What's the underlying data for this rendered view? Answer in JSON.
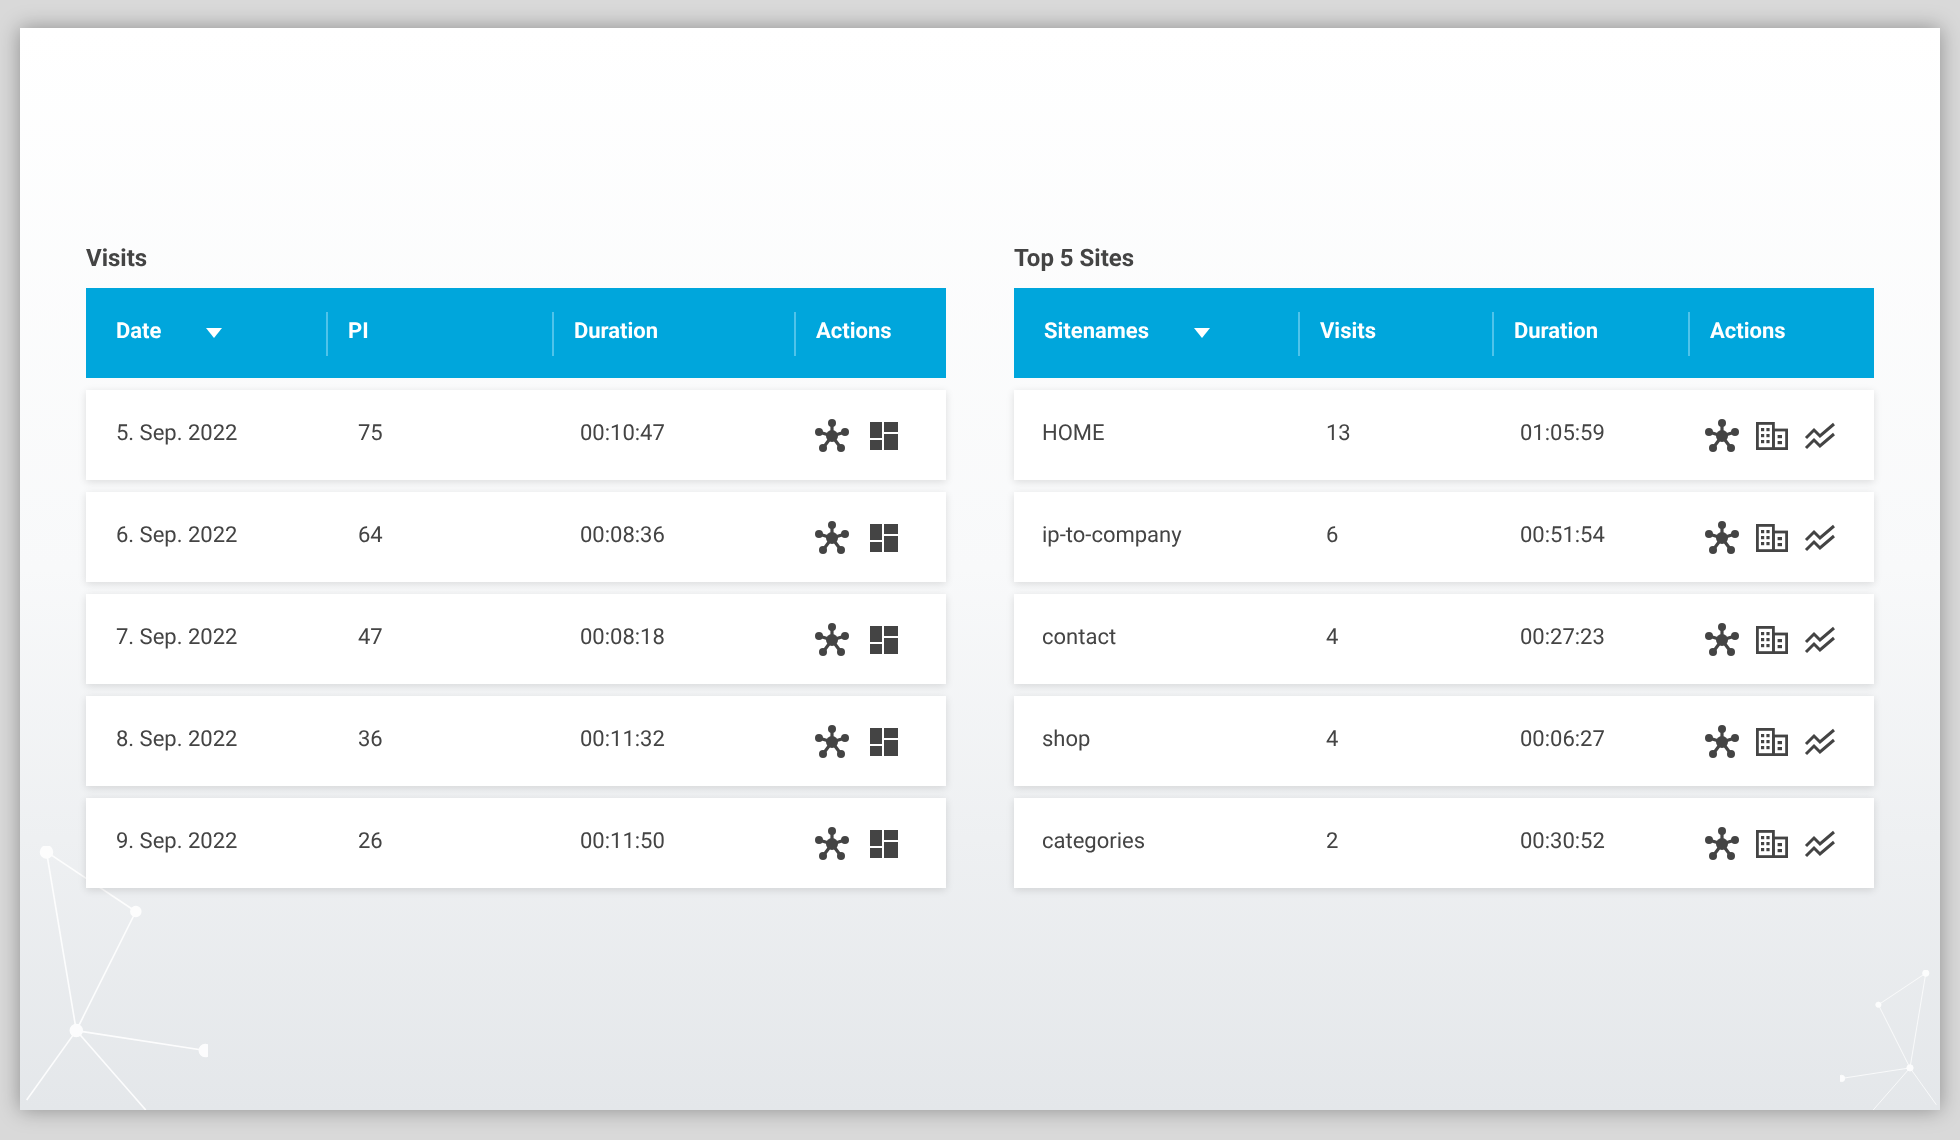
{
  "tables": [
    {
      "title": "Visits",
      "columns": [
        {
          "label": "Date",
          "sorted": true
        },
        {
          "label": "PI",
          "sorted": false
        },
        {
          "label": "Duration",
          "sorted": false
        },
        {
          "label": "Actions",
          "sorted": false
        }
      ],
      "rows": [
        {
          "cells": [
            "5. Sep. 2022",
            "75",
            "00:10:47"
          ],
          "actions": [
            {
              "kind": "network"
            },
            {
              "kind": "dashboard"
            }
          ]
        },
        {
          "cells": [
            "6. Sep. 2022",
            "64",
            "00:08:36"
          ],
          "actions": [
            {
              "kind": "network"
            },
            {
              "kind": "dashboard"
            }
          ]
        },
        {
          "cells": [
            "7. Sep. 2022",
            "47",
            "00:08:18"
          ],
          "actions": [
            {
              "kind": "network"
            },
            {
              "kind": "dashboard"
            }
          ]
        },
        {
          "cells": [
            "8. Sep. 2022",
            "36",
            "00:11:32"
          ],
          "actions": [
            {
              "kind": "network"
            },
            {
              "kind": "dashboard"
            }
          ]
        },
        {
          "cells": [
            "9. Sep. 2022",
            "26",
            "00:11:50"
          ],
          "actions": [
            {
              "kind": "network"
            },
            {
              "kind": "dashboard"
            }
          ]
        }
      ]
    },
    {
      "title": "Top 5 Sites",
      "columns": [
        {
          "label": "Sitenames",
          "sorted": true
        },
        {
          "label": "Visits",
          "sorted": false
        },
        {
          "label": "Duration",
          "sorted": false
        },
        {
          "label": "Actions",
          "sorted": false
        }
      ],
      "rows": [
        {
          "cells": [
            "HOME",
            "13",
            "01:05:59"
          ],
          "actions": [
            {
              "kind": "network"
            },
            {
              "kind": "building"
            },
            {
              "kind": "trend"
            }
          ]
        },
        {
          "cells": [
            "ip-to-company",
            "6",
            "00:51:54"
          ],
          "actions": [
            {
              "kind": "network"
            },
            {
              "kind": "building"
            },
            {
              "kind": "trend"
            }
          ]
        },
        {
          "cells": [
            "contact",
            "4",
            "00:27:23"
          ],
          "actions": [
            {
              "kind": "network"
            },
            {
              "kind": "building"
            },
            {
              "kind": "trend"
            }
          ]
        },
        {
          "cells": [
            "shop",
            "4",
            "00:06:27"
          ],
          "actions": [
            {
              "kind": "network"
            },
            {
              "kind": "building"
            },
            {
              "kind": "trend"
            }
          ]
        },
        {
          "cells": [
            "categories",
            "2",
            "00:30:52"
          ],
          "actions": [
            {
              "kind": "network"
            },
            {
              "kind": "building"
            },
            {
              "kind": "trend"
            }
          ]
        }
      ]
    }
  ]
}
